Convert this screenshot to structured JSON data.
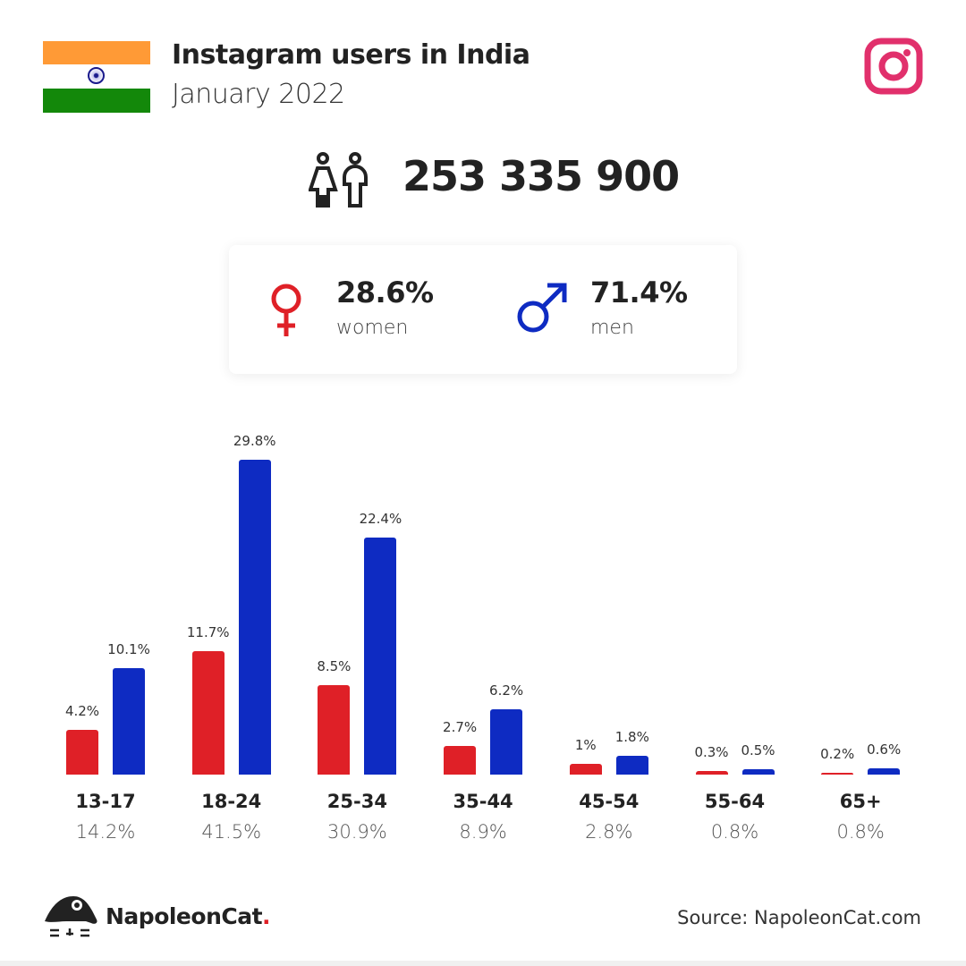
{
  "header": {
    "title": "Instagram users in India",
    "subtitle": "January 2022",
    "total": "253 335 900"
  },
  "gender": {
    "women_pct": "28.6%",
    "women_label": "women",
    "men_pct": "71.4%",
    "men_label": "men"
  },
  "colors": {
    "women": "#df2027",
    "men": "#0e2bc2",
    "instagram": "#e1306c"
  },
  "chart_data": {
    "type": "bar",
    "categories": [
      "13-17",
      "18-24",
      "25-34",
      "35-44",
      "45-54",
      "55-64",
      "65+"
    ],
    "totals": [
      "14.2%",
      "41.5%",
      "30.9%",
      "8.9%",
      "2.8%",
      "0.8%",
      "0.8%"
    ],
    "series": [
      {
        "name": "women",
        "values": [
          4.2,
          11.7,
          8.5,
          2.7,
          1,
          0.3,
          0.2
        ],
        "labels": [
          "4.2%",
          "11.7%",
          "8.5%",
          "2.7%",
          "1%",
          "0.3%",
          "0.2%"
        ]
      },
      {
        "name": "men",
        "values": [
          10.1,
          29.8,
          22.4,
          6.2,
          1.8,
          0.5,
          0.6
        ],
        "labels": [
          "10.1%",
          "29.8%",
          "22.4%",
          "6.2%",
          "1.8%",
          "0.5%",
          "0.6%"
        ]
      }
    ],
    "ylim": [
      0,
      30
    ]
  },
  "footer": {
    "brand": "NapoleonCat",
    "brand_dot": ".",
    "source": "Source: NapoleonCat.com"
  }
}
